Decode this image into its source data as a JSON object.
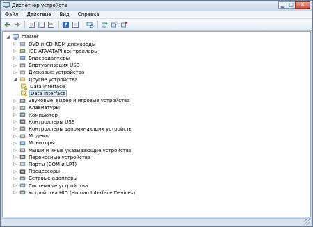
{
  "window": {
    "title": "Диспетчер устройств"
  },
  "menu": [
    "Файл",
    "Действие",
    "Вид",
    "Справка"
  ],
  "toolbar": {
    "buttons": [
      "back-arrow-icon",
      "forward-arrow-icon",
      "properties-icon",
      "panel-icon",
      "help-icon",
      "scan-hardware-icon",
      "update-driver-icon",
      "disable-device-icon",
      "uninstall-device-icon"
    ]
  },
  "tree": {
    "root": "master",
    "items": [
      {
        "label": "DVD и CD-ROM дисководы",
        "icon": "dvd-drive-icon",
        "expand": "▷"
      },
      {
        "label": "IDE ATA/ATAPI контроллеры",
        "icon": "ide-controller-icon",
        "expand": "▷"
      },
      {
        "label": "Видеоадаптеры",
        "icon": "display-adapter-icon",
        "expand": "▷"
      },
      {
        "label": "Виртуализация USB",
        "icon": "usb-virtualization-icon",
        "expand": "▷"
      },
      {
        "label": "Дисковые устройства",
        "icon": "disk-drive-icon",
        "expand": "▷"
      },
      {
        "label": "Другие устройства",
        "icon": "other-devices-icon",
        "expand": "◢"
      },
      {
        "label": "Data Interface",
        "icon": "unknown-device-icon",
        "child": true
      },
      {
        "label": "Data Interface",
        "icon": "unknown-device-icon",
        "child": true,
        "selected": true
      },
      {
        "label": "Звуковые, видео и игровые устройства",
        "icon": "sound-device-icon",
        "expand": "▷"
      },
      {
        "label": "Клавиатуры",
        "icon": "keyboard-icon",
        "expand": "▷"
      },
      {
        "label": "Компьютер",
        "icon": "computer-icon",
        "expand": "▷"
      },
      {
        "label": "Контроллеры USB",
        "icon": "usb-controller-icon",
        "expand": "▷"
      },
      {
        "label": "Контроллеры запоминающих устройств",
        "icon": "storage-controller-icon",
        "expand": "▷"
      },
      {
        "label": "Модемы",
        "icon": "modem-icon",
        "expand": "▷"
      },
      {
        "label": "Мониторы",
        "icon": "monitor-icon",
        "expand": "▷"
      },
      {
        "label": "Мыши и иные указывающие устройства",
        "icon": "mouse-icon",
        "expand": "▷"
      },
      {
        "label": "Переносные устройства",
        "icon": "portable-device-icon",
        "expand": "▷"
      },
      {
        "label": "Порты (COM и LPT)",
        "icon": "port-icon",
        "expand": "▷"
      },
      {
        "label": "Процессоры",
        "icon": "processor-icon",
        "expand": "▷"
      },
      {
        "label": "Сетевые адаптеры",
        "icon": "network-adapter-icon",
        "expand": "▷"
      },
      {
        "label": "Системные устройства",
        "icon": "system-device-icon",
        "expand": "▷"
      },
      {
        "label": "Устройства HID (Human Interface Devices)",
        "icon": "hid-device-icon",
        "expand": "▷"
      }
    ]
  },
  "colors": {
    "selection": "#dceaf8",
    "selection_border": "#8db5de",
    "frame": "#cfdbe7",
    "accent": "#1f6fc5"
  }
}
